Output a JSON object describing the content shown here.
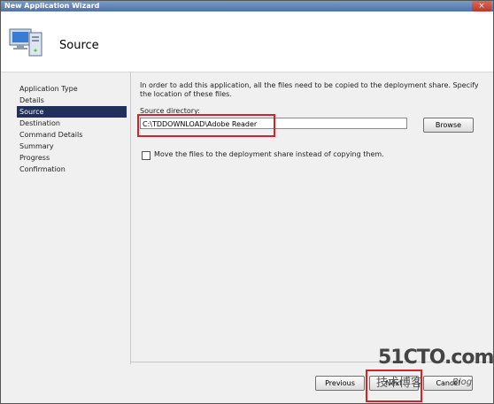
{
  "window": {
    "title": "New Application Wizard",
    "close_glyph": "×"
  },
  "header": {
    "title": "Source",
    "icon": "computer-icon"
  },
  "nav": {
    "items": [
      {
        "label": "Application Type",
        "selected": false
      },
      {
        "label": "Details",
        "selected": false
      },
      {
        "label": "Source",
        "selected": true
      },
      {
        "label": "Destination",
        "selected": false
      },
      {
        "label": "Command Details",
        "selected": false
      },
      {
        "label": "Summary",
        "selected": false
      },
      {
        "label": "Progress",
        "selected": false
      },
      {
        "label": "Confirmation",
        "selected": false
      }
    ]
  },
  "content": {
    "intro": "In order to add this application, all the files need to be copied to the deployment share.  Specify the location of these files.",
    "source_label": "Source directory:",
    "source_value": "C:\\TDDOWNLOAD\\Adobe Reader",
    "browse_label": "Browse",
    "move_label": "Move the files to the deployment share instead of copying them.",
    "move_checked": false
  },
  "buttons": {
    "previous": "Previous",
    "next": "Next",
    "cancel": "Cancel"
  },
  "watermark": {
    "line1": "51CTO.com",
    "line2": "技术博客",
    "line3": "Blog"
  },
  "colors": {
    "selected_bg": "#20305a",
    "highlight_red": "#d4222a",
    "title_bar": "#4e73a8"
  }
}
